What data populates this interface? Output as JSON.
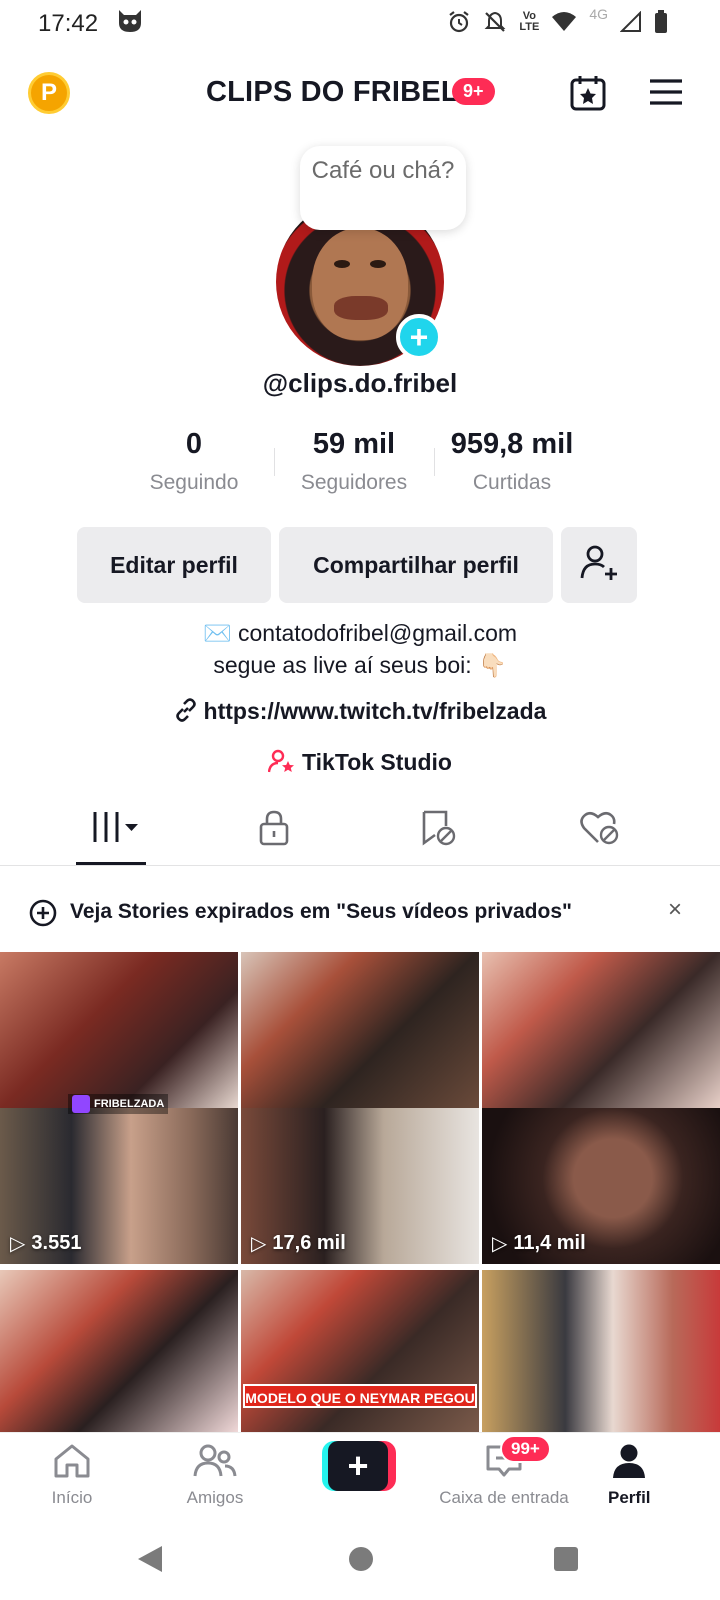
{
  "status_bar": {
    "time": "17:42",
    "lte_top": "Vo",
    "lte_bottom": "LTE",
    "network": "4G"
  },
  "header": {
    "title": "CLIPS DO FRIBEL",
    "badge": "9+",
    "coin_letter": "P"
  },
  "profile": {
    "note": "Café ou chá?",
    "username": "@clips.do.fribel",
    "add_symbol": "+"
  },
  "stats": [
    {
      "value": "0",
      "label": "Seguindo"
    },
    {
      "value": "59 mil",
      "label": "Seguidores"
    },
    {
      "value": "959,8 mil",
      "label": "Curtidas"
    }
  ],
  "buttons": {
    "edit": "Editar perfil",
    "share": "Compartilhar perfil"
  },
  "bio": {
    "email": "✉️ contatodofribel@gmail.com",
    "line2": "segue as live aí seus boi: 👇🏻",
    "link": "https://www.twitch.tv/fribelzada",
    "studio": "TikTok Studio"
  },
  "tabs": [
    "videos",
    "private",
    "reposts",
    "liked"
  ],
  "banner": {
    "text": "Veja Stories expirados em \"Seus vídeos privados\"",
    "close": "×"
  },
  "grid": {
    "views": [
      "3.551",
      "17,6 mil",
      "11,4 mil"
    ],
    "twitch_tag": "FRIBELZADA",
    "caption": "MODELO QUE O NEYMAR PEGOU"
  },
  "bottom_nav": {
    "home": "Início",
    "friends": "Amigos",
    "inbox": "Caixa de entrada",
    "inbox_badge": "99+",
    "profile": "Perfil",
    "create": "+"
  }
}
